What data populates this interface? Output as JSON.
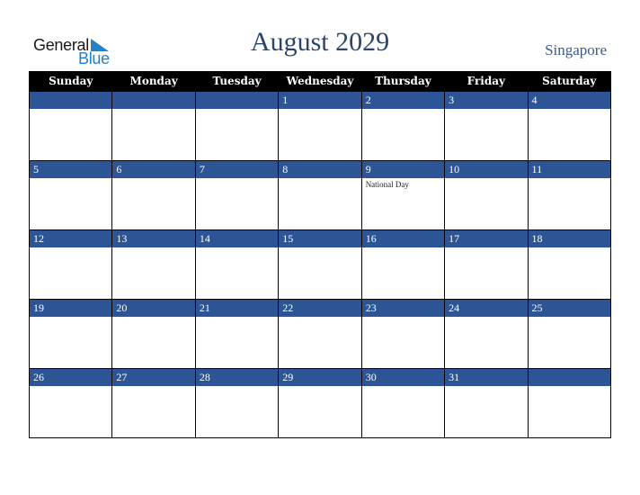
{
  "logo": {
    "word1": "General",
    "word2": "Blue"
  },
  "header": {
    "title": "August 2029",
    "country": "Singapore"
  },
  "calendar": {
    "weekdays": [
      "Sunday",
      "Monday",
      "Tuesday",
      "Wednesday",
      "Thursday",
      "Friday",
      "Saturday"
    ],
    "weeks": [
      [
        {
          "day": ""
        },
        {
          "day": ""
        },
        {
          "day": ""
        },
        {
          "day": "1"
        },
        {
          "day": "2"
        },
        {
          "day": "3"
        },
        {
          "day": "4"
        }
      ],
      [
        {
          "day": "5"
        },
        {
          "day": "6"
        },
        {
          "day": "7"
        },
        {
          "day": "8"
        },
        {
          "day": "9",
          "holiday": "National Day"
        },
        {
          "day": "10"
        },
        {
          "day": "11"
        }
      ],
      [
        {
          "day": "12"
        },
        {
          "day": "13"
        },
        {
          "day": "14"
        },
        {
          "day": "15"
        },
        {
          "day": "16"
        },
        {
          "day": "17"
        },
        {
          "day": "18"
        }
      ],
      [
        {
          "day": "19"
        },
        {
          "day": "20"
        },
        {
          "day": "21"
        },
        {
          "day": "22"
        },
        {
          "day": "23"
        },
        {
          "day": "24"
        },
        {
          "day": "25"
        }
      ],
      [
        {
          "day": "26"
        },
        {
          "day": "27"
        },
        {
          "day": "28"
        },
        {
          "day": "29"
        },
        {
          "day": "30"
        },
        {
          "day": "31"
        },
        {
          "day": ""
        }
      ]
    ]
  },
  "colors": {
    "band": "#2d5596",
    "header_bg": "#000000",
    "title": "#2b446e",
    "logo_blue": "#2a7fc4"
  }
}
